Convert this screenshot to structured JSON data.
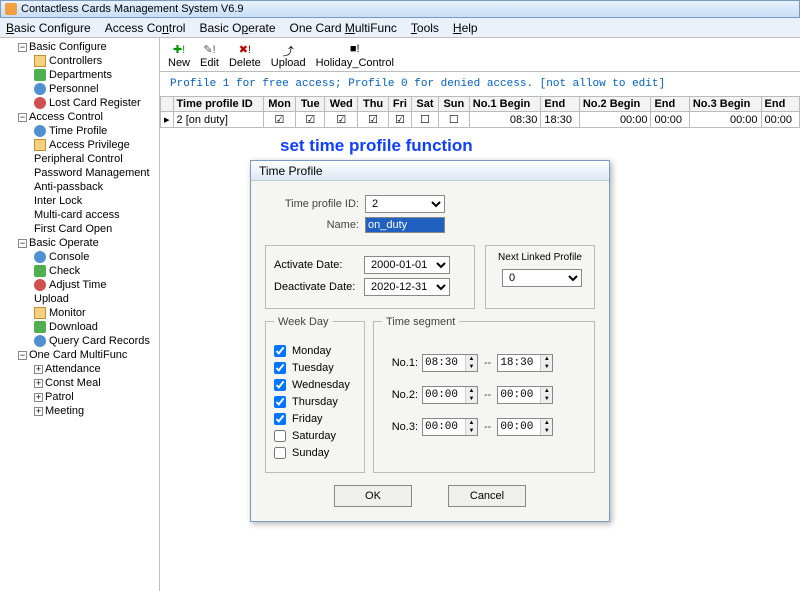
{
  "window": {
    "title": "Contactless Cards Management System  V6.9"
  },
  "menubar": [
    "Basic Configure",
    "Access Control",
    "Basic Operate",
    "One Card MultiFunc",
    "Tools",
    "Help"
  ],
  "menubar_hotkeys": [
    "B",
    "n",
    "p",
    "M",
    "T",
    "H"
  ],
  "tree": {
    "root1": "Basic Configure",
    "r1": [
      "Controllers",
      "Departments",
      "Personnel",
      "Lost Card Register"
    ],
    "root2": "Access Control",
    "r2": [
      "Time Profile",
      "Access Privilege",
      "Peripheral Control",
      "Password Management",
      "Anti-passback",
      "Inter Lock",
      "Multi-card access",
      "First Card Open"
    ],
    "root3": "Basic Operate",
    "r3": [
      "Console",
      "Check",
      "Adjust Time",
      "Upload",
      "Monitor",
      "Download",
      "Query Card Records"
    ],
    "root4": "One Card MultiFunc",
    "r4": [
      "Attendance",
      "Const Meal",
      "Patrol",
      "Meeting"
    ]
  },
  "toolbar": [
    "New",
    "Edit",
    "Delete",
    "Upload",
    "Holiday_Control"
  ],
  "hint": "Profile 1 for free access; Profile 0  for denied access.  [not allow to edit]",
  "grid": {
    "headers": [
      "Time profile ID",
      "Mon",
      "Tue",
      "Wed",
      "Thu",
      "Fri",
      "Sat",
      "Sun",
      "No.1 Begin",
      "End",
      "No.2 Begin",
      "End",
      "No.3 Begin",
      "End"
    ],
    "row": {
      "id": "2 [on duty]",
      "days": [
        true,
        true,
        true,
        true,
        true,
        false,
        false
      ],
      "t1b": "08:30",
      "t1e": "18:30",
      "t2b": "00:00",
      "t2e": "00:00",
      "t3b": "00:00",
      "t3e": "00:00"
    }
  },
  "overlay": "set time profile function",
  "dialog": {
    "title": "Time Profile",
    "id_label": "Time profile ID:",
    "id_value": "2",
    "name_label": "Name:",
    "name_value": "on_duty",
    "activate_label": "Activate Date:",
    "activate_value": "2000-01-01",
    "deactivate_label": "Deactivate Date:",
    "deactivate_value": "2020-12-31",
    "next_label": "Next Linked Profile",
    "next_value": "0",
    "weekday_title": "Week Day",
    "days": [
      {
        "name": "Monday",
        "checked": true
      },
      {
        "name": "Tuesday",
        "checked": true
      },
      {
        "name": "Wednesday",
        "checked": true
      },
      {
        "name": "Thursday",
        "checked": true
      },
      {
        "name": "Friday",
        "checked": true
      },
      {
        "name": "Saturday",
        "checked": false
      },
      {
        "name": "Sunday",
        "checked": false
      }
    ],
    "segment_title": "Time segment",
    "segments": [
      {
        "label": "No.1:",
        "from": "08:30",
        "to": "18:30"
      },
      {
        "label": "No.2:",
        "from": "00:00",
        "to": "00:00"
      },
      {
        "label": "No.3:",
        "from": "00:00",
        "to": "00:00"
      }
    ],
    "ok": "OK",
    "cancel": "Cancel"
  }
}
